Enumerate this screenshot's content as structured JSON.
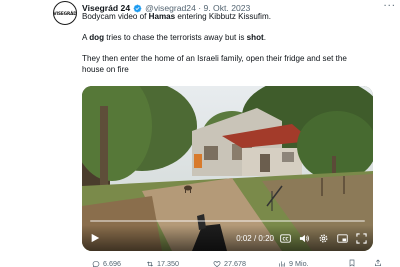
{
  "author": {
    "avatar_text": "VISEGRÁD",
    "name": "Visegrád 24",
    "handle": "@visegrad24",
    "date": "9. Okt. 2023",
    "more_icon": "more-dots-icon"
  },
  "tweet": {
    "line1_a": "Bodycam video of ",
    "line1_b": "Hamas",
    "line1_c": " entering Kibbutz Kissufim.",
    "line2_a": "A ",
    "line2_b": "dog",
    "line2_c": " tries to chase the terrorists away but is ",
    "line2_d": "shot",
    "line2_e": ".",
    "line3": "They then enter the home of an Israeli family, open their fridge and set the",
    "line4": "house on fire"
  },
  "video": {
    "progress": 0.0,
    "time": "0:02 / 0:20"
  },
  "actions": {
    "replies": "6.696",
    "reposts": "17.350",
    "likes": "27.678",
    "views": "9 Mio."
  },
  "colors": {
    "verified": "#1d9bf0",
    "muted": "#536471"
  }
}
